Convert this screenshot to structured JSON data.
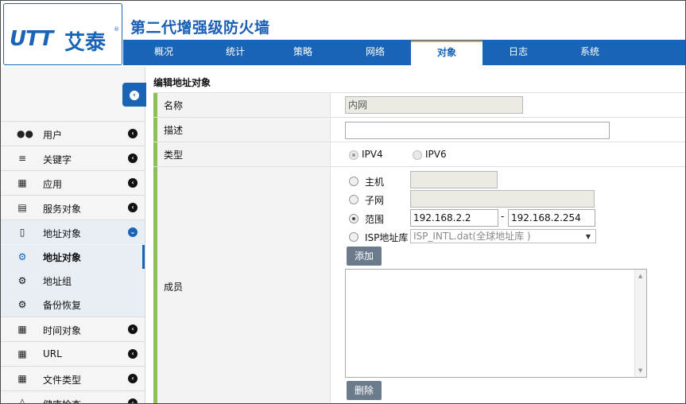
{
  "app": {
    "logo_mark": "UTT",
    "logo_name": "艾泰",
    "logo_reg": "®",
    "title": "第二代增强级防火墙"
  },
  "nav": {
    "tabs": [
      {
        "label": "概况",
        "active": false
      },
      {
        "label": "统计",
        "active": false
      },
      {
        "label": "策略",
        "active": false
      },
      {
        "label": "网络",
        "active": false
      },
      {
        "label": "对象",
        "active": true
      },
      {
        "label": "日志",
        "active": false
      },
      {
        "label": "系统",
        "active": false
      }
    ]
  },
  "sidebar": {
    "collapse_icon": "chevron-left-icon",
    "items": [
      {
        "label": "用户",
        "icon": "users-icon"
      },
      {
        "label": "关键字",
        "icon": "list-icon"
      },
      {
        "label": "应用",
        "icon": "grid-icon"
      },
      {
        "label": "服务对象",
        "icon": "server-icon"
      },
      {
        "label": "地址对象",
        "icon": "file-icon",
        "open": true
      },
      {
        "label": "时间对象",
        "icon": "calendar-icon"
      },
      {
        "label": "URL",
        "icon": "calendar-icon"
      },
      {
        "label": "文件类型",
        "icon": "calendar-icon"
      },
      {
        "label": "健康检查",
        "icon": "sitemap-icon"
      }
    ],
    "subitems": [
      {
        "label": "地址对象",
        "icon": "gear-icon",
        "active": true
      },
      {
        "label": "地址组",
        "icon": "gear-icon"
      },
      {
        "label": "备份恢复",
        "icon": "gear-icon"
      }
    ]
  },
  "form": {
    "section_title": "编辑地址对象",
    "name_label": "名称",
    "name_value": "内网",
    "desc_label": "描述",
    "desc_value": "",
    "type_label": "类型",
    "type_options": [
      "IPV4",
      "IPV6"
    ],
    "type_selected": "IPV4",
    "member_label": "成员",
    "member_options": {
      "host": "主机",
      "subnet": "子网",
      "range": "范围",
      "isp": "ISP地址库"
    },
    "member_selected": "范围",
    "host_value": "",
    "subnet_value": "",
    "range_start": "192.168.2.2",
    "range_separator": "-",
    "range_end": "192.168.2.254",
    "isp_select": "ISP_INTL.dat(全球地址库 )",
    "add_button": "添加",
    "delete_button": "删除",
    "members_list": []
  }
}
